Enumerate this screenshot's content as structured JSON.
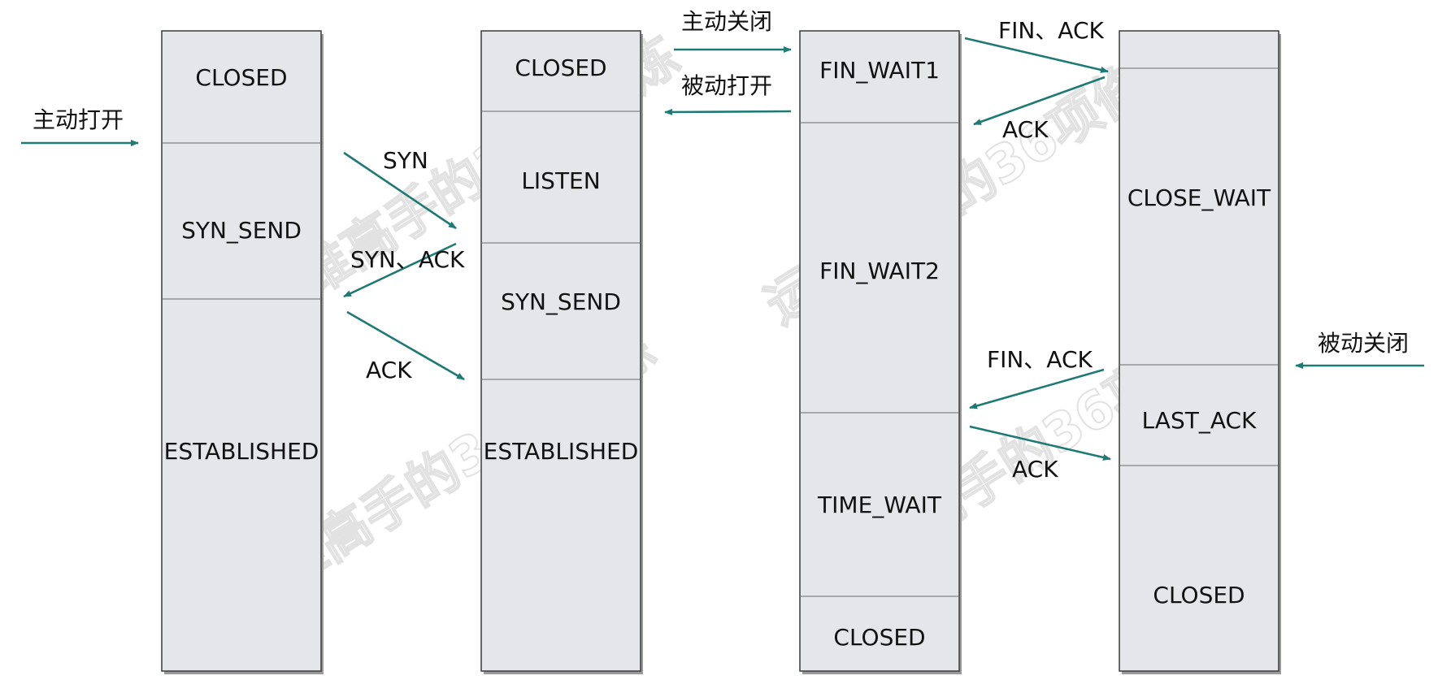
{
  "watermark_text": "运维高手的36项修炼",
  "columns": [
    {
      "id": "client-handshake",
      "states": [
        "CLOSED",
        "SYN_SEND",
        "ESTABLISHED"
      ]
    },
    {
      "id": "server-handshake",
      "states": [
        "CLOSED",
        "LISTEN",
        "SYN_SEND",
        "ESTABLISHED"
      ]
    },
    {
      "id": "active-close",
      "states": [
        "FIN_WAIT1",
        "FIN_WAIT2",
        "TIME_WAIT",
        "CLOSED"
      ]
    },
    {
      "id": "passive-close",
      "states": [
        "",
        "CLOSE_WAIT",
        "LAST_ACK",
        "CLOSED"
      ]
    }
  ],
  "messages": [
    {
      "id": "active-open",
      "label": "主动打开"
    },
    {
      "id": "syn",
      "label": "SYN"
    },
    {
      "id": "syn-ack",
      "label": "SYN、ACK"
    },
    {
      "id": "ack-handshake",
      "label": "ACK"
    },
    {
      "id": "active-close",
      "label": "主动关闭"
    },
    {
      "id": "passive-open",
      "label": "被动打开"
    },
    {
      "id": "fin-ack-1",
      "label": "FIN、ACK"
    },
    {
      "id": "ack-close-1",
      "label": "ACK"
    },
    {
      "id": "fin-ack-2",
      "label": "FIN、ACK"
    },
    {
      "id": "ack-close-2",
      "label": "ACK"
    },
    {
      "id": "passive-close",
      "label": "被动关闭"
    }
  ],
  "colors": {
    "arrow": "#1e7a72",
    "box_fill": "#e5e6ea",
    "watermark": "#e2e2e2"
  }
}
